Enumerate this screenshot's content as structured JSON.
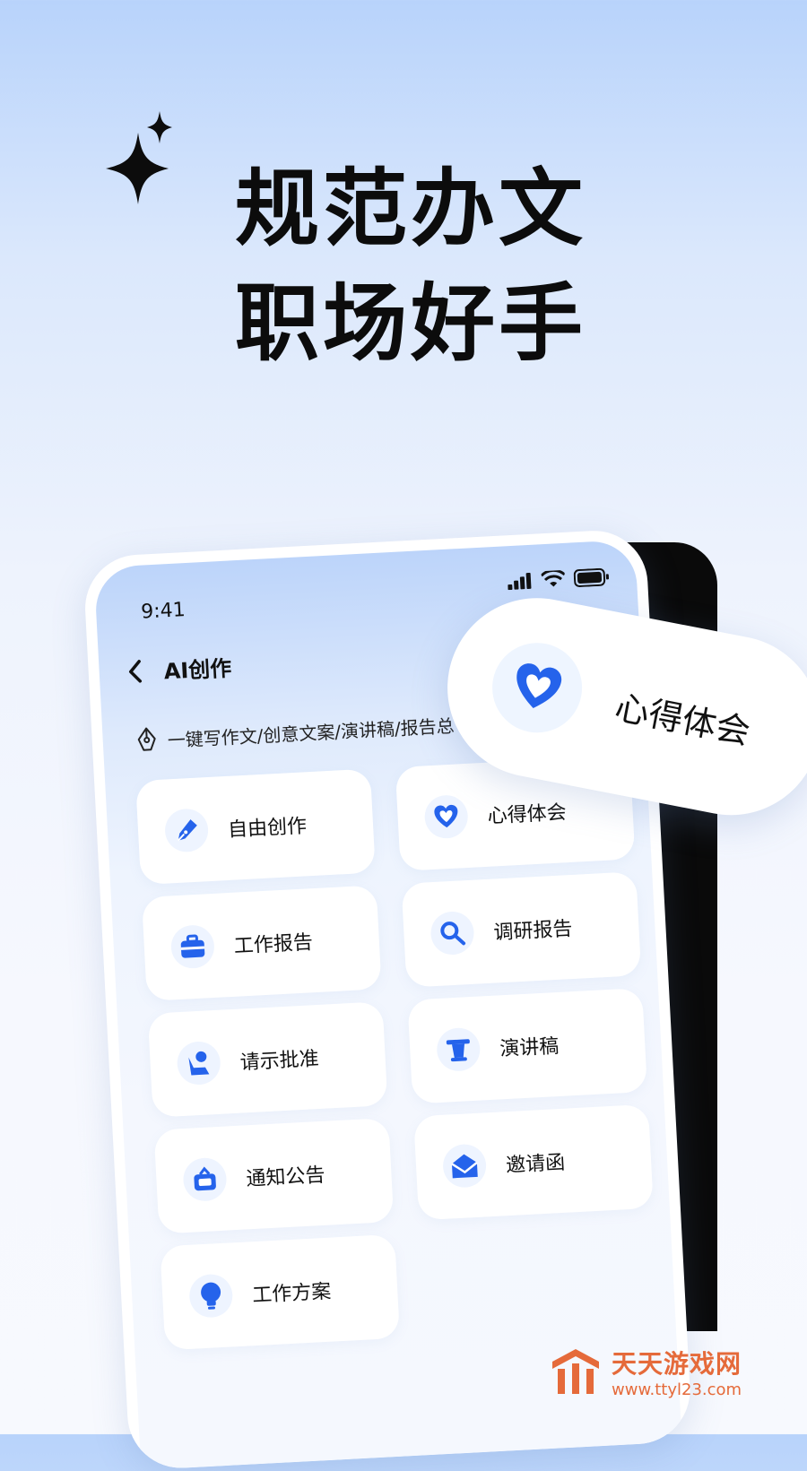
{
  "headline": {
    "line1": "规范办文",
    "line2": "职场好手"
  },
  "status_bar": {
    "time": "9:41"
  },
  "nav": {
    "back_icon": "chevron-left-icon",
    "title": "AI创作"
  },
  "subtitle": {
    "icon": "pen-nib-icon",
    "text": "一键写作文/创意文案/演讲稿/报告总"
  },
  "cards": [
    {
      "label": "自由创作",
      "icon": "pen-icon"
    },
    {
      "label": "心得体会",
      "icon": "heart-icon"
    },
    {
      "label": "工作报告",
      "icon": "briefcase-icon"
    },
    {
      "label": "调研报告",
      "icon": "search-icon"
    },
    {
      "label": "请示批准",
      "icon": "person-icon"
    },
    {
      "label": "演讲稿",
      "icon": "podium-icon"
    },
    {
      "label": "通知公告",
      "icon": "notice-board-icon"
    },
    {
      "label": "邀请函",
      "icon": "envelope-icon"
    },
    {
      "label": "工作方案",
      "icon": "lightbulb-icon"
    }
  ],
  "float_card": {
    "label": "心得体会",
    "icon": "heart-icon"
  },
  "watermark": {
    "title": "天天游戏网",
    "url": "www.ttyl23.com"
  },
  "colors": {
    "accent": "#2563eb",
    "icon_bg": "#eef4ff",
    "watermark": "#e56a3a"
  }
}
